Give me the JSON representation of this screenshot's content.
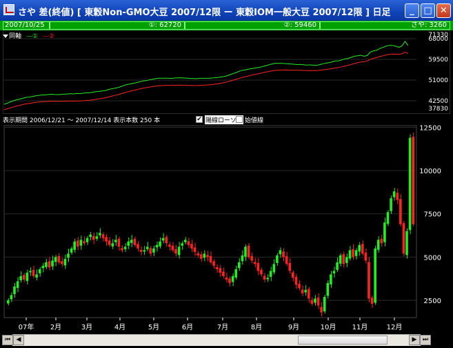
{
  "window": {
    "title": "さや 差(終値) [ 東穀Non-GMO大豆 2007/12限 ー 東穀IOM一般大豆 2007/12限 ] 日足",
    "minimize": "_",
    "maximize": "□",
    "close": "✕"
  },
  "infobar": {
    "date": "2007/10/25",
    "s1": "①: 62720",
    "s2": "②: 59460",
    "saya": "さや: 3260"
  },
  "top_panel": {
    "legend_prefix": "同軸",
    "legend_1": "①",
    "legend_2": "②",
    "y_ticks": [
      "71330",
      "68000",
      "59500",
      "51000",
      "42500",
      "37830"
    ],
    "line_color_1": "#22ee22",
    "line_color_2": "#ff2222"
  },
  "separator": {
    "period_text": "表示期間 2006/12/21 ～ 2007/12/14 表示本数 250 本",
    "check1_label": "陽線ローソク",
    "check2_label": "始値線",
    "check1_checked": "✔"
  },
  "chart_data": {
    "type": "candlestick",
    "title": "",
    "x_labels": [
      "07年",
      "2月",
      "3月",
      "4月",
      "5月",
      "6月",
      "7月",
      "8月",
      "9月",
      "10月",
      "11月",
      "12月"
    ],
    "ylim": [
      1500,
      12600
    ],
    "y_ticks": [
      2500,
      5000,
      7500,
      10000,
      12500
    ],
    "up_color": "#22ee22",
    "down_color": "#ff2222",
    "closes_sampled": [
      2500,
      2800,
      3300,
      3600,
      3900,
      3700,
      4100,
      4200,
      3900,
      4000,
      4300,
      4500,
      4700,
      4400,
      4800,
      5000,
      4700,
      4600,
      4900,
      5200,
      5500,
      5900,
      5600,
      6000,
      5800,
      6100,
      6300,
      6000,
      6200,
      6400,
      6100,
      5900,
      5700,
      5800,
      6000,
      5600,
      5400,
      5600,
      5900,
      6000,
      5700,
      5500,
      5300,
      5400,
      5600,
      5200,
      5500,
      5700,
      5900,
      6100,
      5800,
      5600,
      5400,
      5200,
      5600,
      5800,
      6000,
      5700,
      5500,
      5300,
      5100,
      4900,
      5200,
      5000,
      4700,
      4500,
      4300,
      4100,
      3900,
      3700,
      3500,
      3900,
      4300,
      4700,
      5100,
      5600,
      5000,
      4800,
      4600,
      4200,
      4000,
      3700,
      3800,
      4200,
      4600,
      5100,
      5400,
      5000,
      4600,
      4200,
      3800,
      3400,
      3200,
      2900,
      3100,
      2600,
      2300,
      2600,
      2200,
      1800,
      2700,
      3500,
      4000,
      4200,
      4700,
      5100,
      4600,
      5000,
      5400,
      5000,
      5400,
      5700,
      5200,
      4800,
      2600,
      2300,
      5500,
      6000,
      5800,
      7000,
      7600,
      8400,
      8800,
      8300,
      6900,
      5200,
      6500,
      11900,
      6900
    ]
  },
  "scrollbar": {
    "left_end": "⏮",
    "left": "◀",
    "right": "▶",
    "right_end": "⏭"
  }
}
